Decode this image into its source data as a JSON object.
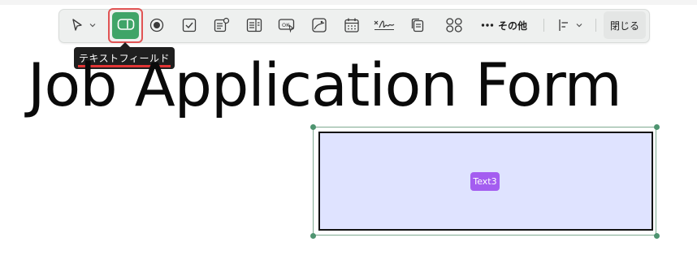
{
  "toolbar": {
    "tools": [
      {
        "name": "select-tool",
        "icon": "pointer-icon"
      },
      {
        "name": "text-field-tool",
        "icon": "text-field-icon",
        "active": true
      },
      {
        "name": "radio-button-tool",
        "icon": "radio-button-icon"
      },
      {
        "name": "checkbox-tool",
        "icon": "checkbox-icon"
      },
      {
        "name": "combo-box-tool",
        "icon": "combo-box-icon"
      },
      {
        "name": "list-box-tool",
        "icon": "list-box-icon"
      },
      {
        "name": "button-tool",
        "icon": "ok-button-icon"
      },
      {
        "name": "image-field-tool",
        "icon": "image-field-icon"
      },
      {
        "name": "date-field-tool",
        "icon": "calendar-icon"
      },
      {
        "name": "signature-field-tool",
        "icon": "signature-icon"
      },
      {
        "name": "copy-fields-tool",
        "icon": "copy-icon"
      },
      {
        "name": "layout-tool",
        "icon": "grid-icon"
      }
    ],
    "more_label": "その他",
    "close_label": "閉じる",
    "accent_color": "#3fa468",
    "highlight_color": "#e15454"
  },
  "tooltip": {
    "text": "テキストフィールド"
  },
  "document": {
    "title": "Job Application Form"
  },
  "text_field": {
    "badge": "Text3",
    "fill_color": "#dfe3ff",
    "badge_color": "#a45df0"
  }
}
